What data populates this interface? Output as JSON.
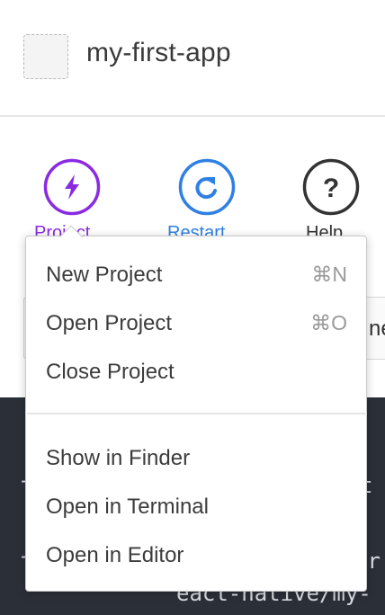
{
  "app": {
    "title": "my-first-app"
  },
  "toolbar": {
    "project": {
      "label": "Project",
      "icon": "lightning-icon",
      "color": "#8a2be2"
    },
    "restart": {
      "label": "Restart",
      "icon": "refresh-icon",
      "color": "#2f80e4"
    },
    "help": {
      "label": "Help",
      "icon": "question-icon",
      "color": "#333333"
    }
  },
  "background": {
    "input_visible_text": "ne",
    "terminal_lines": [
      "-",
      "t",
      "er",
      "eact-native/my-"
    ]
  },
  "menu": {
    "section1": [
      {
        "label": "New Project",
        "shortcut": "⌘N"
      },
      {
        "label": "Open Project",
        "shortcut": "⌘O"
      },
      {
        "label": "Close Project",
        "shortcut": ""
      }
    ],
    "section2": [
      {
        "label": "Show in Finder"
      },
      {
        "label": "Open in Terminal"
      },
      {
        "label": "Open in Editor"
      }
    ]
  }
}
